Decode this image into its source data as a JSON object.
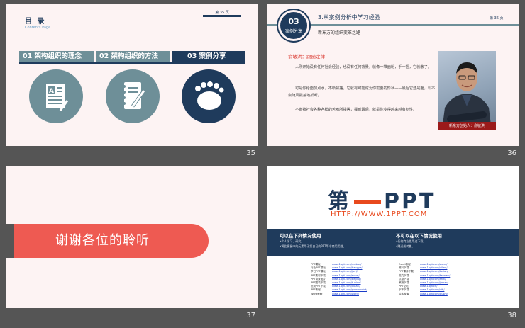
{
  "slides": [
    {
      "number": "35",
      "title": "目 录",
      "subtitle": "Contents Page",
      "page_label": "第 35 页",
      "tabs": [
        "01 架构组织的理念",
        "02 架构组织的方法",
        "03 案例分享"
      ],
      "icons": [
        "document-icon",
        "notebook-pencil-icon",
        "footprint-icon"
      ]
    },
    {
      "number": "36",
      "badge_number": "03",
      "badge_label": "案例分享",
      "title": "3.从案例分析中学习经验",
      "page_label": "第 36 页",
      "subtitle": "新东方的组织变革之路",
      "heading": "俞敏洪：跟随定律",
      "paragraphs": [
        "人刚开始没有任何社会经验，也没有任何背景，就像一堆面粉，手一捏，它就散了。",
        "可是你给面加点水，不断揉搓，它就有可能成为你需要的形状——最后它还是面，却不会随风飘荡地折断。",
        "不断被社会各种各样的苦难所揉搓，揉到最后，就是你变得越来越有韧性。"
      ],
      "photo_caption": "新东方创始人：俞敏洪"
    },
    {
      "number": "37",
      "banner_text": "谢谢各位的聆听"
    },
    {
      "number": "38",
      "logo_left": "第",
      "logo_right": "PPT",
      "url": "HTTP://WWW.1PPT.COM",
      "col_a_title": "可以在下列情况使用",
      "col_a_items": [
        "•个人学习、研究。",
        "•将此模板中的元素用于您自己的PPT等非商用用途。"
      ],
      "col_b_title": "不可以在以下情况使用",
      "col_b_items": [
        "•任何商业性用途下载。",
        "•赠送或转售。"
      ],
      "links_a": [
        {
          "k": "PPT模板",
          "v": "www.1ppt.com/moban/"
        },
        {
          "k": "行业PPT模板",
          "v": "www.1ppt.com/hangye/"
        },
        {
          "k": "节日PPT模板",
          "v": "www.1ppt.com/jieri/"
        },
        {
          "k": "PPT素材下载",
          "v": "www.1ppt.com/sucai/"
        },
        {
          "k": "PPT背景图片",
          "v": "www.1ppt.com/beijing/"
        },
        {
          "k": "PPT图表下载",
          "v": "www.1ppt.com/tubiao/"
        },
        {
          "k": "优秀PPT下载",
          "v": "www.1ppt.com/xiazai/"
        },
        {
          "k": "PPT教程",
          "v": "www.1ppt.com/powerpoint/"
        },
        {
          "k": "Word教程",
          "v": "www.1ppt.com/word/"
        }
      ],
      "links_b": [
        {
          "k": "Excel教程",
          "v": "www.1ppt.com/excel/"
        },
        {
          "k": "资料下载",
          "v": "www.1ppt.com/ziliao/"
        },
        {
          "k": "PPT课件下载",
          "v": "www.1ppt.com/kejian/"
        },
        {
          "k": "范文下载",
          "v": "www.1ppt.com/fanwen/"
        },
        {
          "k": "试卷下载",
          "v": "www.1ppt.com/shiti/"
        },
        {
          "k": "教案下载",
          "v": "www.1ppt.com/jiaoan/"
        },
        {
          "k": "PPT论坛",
          "v": "www.1ppt.cn/"
        },
        {
          "k": "字体下载",
          "v": "www.1ppt.com/ziti/"
        },
        {
          "k": "绘本故事",
          "v": "www.1ppt.com/gushi/"
        }
      ]
    }
  ]
}
